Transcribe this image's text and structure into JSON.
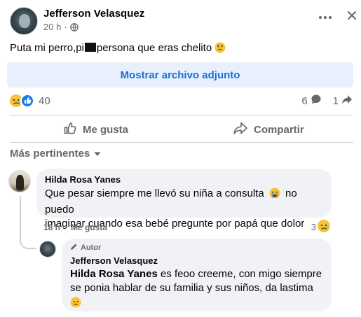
{
  "post": {
    "author": "Jefferson Velasquez",
    "time": "20 h",
    "separator": "·",
    "text_before": "Puta mi perro,pi",
    "text_after": "persona que eras chelito",
    "attachment_button": "Mostrar archivo adjunto",
    "reaction_count": "40",
    "comment_count": "6",
    "share_count": "1"
  },
  "actions": {
    "like": "Me gusta",
    "share": "Compartir"
  },
  "sort": {
    "label": "Más pertinentes"
  },
  "comments": [
    {
      "author": "Hilda Rosa Yanes",
      "text_line1": "Que pesar siempre me llevó su niña a consulta",
      "text_line1_after": "no puedo",
      "text_line2": "imaginar cuando esa bebé pregunte por papá que dolor",
      "time": "18 h",
      "like_label": "Me gusta",
      "reaction_count": "3"
    },
    {
      "badge": "Autor",
      "author": "Jefferson Velasquez",
      "tag": "Hilda Rosa Yanes",
      "text_line1_after_tag": "es feoo creeme, con migo siempre",
      "text_line2": "se ponia hablar de su familia y sus niños, da lastima"
    }
  ],
  "colors": {
    "accent_blue": "#1b6fd6",
    "attachment_bg": "#e7f0fc",
    "bubble_bg": "#f0f2f5",
    "secondary_text": "#65676b",
    "emoji_yellow": "#f7c33b"
  },
  "icons": [
    "globe-icon",
    "more-icon",
    "close-icon",
    "sad-face-icon",
    "like-icon",
    "comment-icon",
    "share-arrow-icon",
    "thumbs-up-icon",
    "share-icon",
    "caret-down-icon",
    "crying-face-icon",
    "pencil-icon",
    "worried-face-icon"
  ]
}
